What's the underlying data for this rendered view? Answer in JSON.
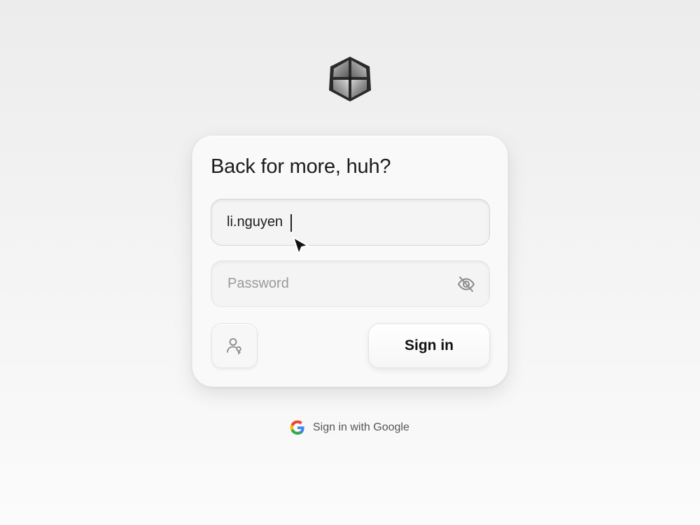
{
  "logo": {
    "icon": "hexagon-logo-icon"
  },
  "form": {
    "title": "Back for more, huh?",
    "username": {
      "value": "li.nguyen",
      "placeholder": ""
    },
    "password": {
      "value": "",
      "placeholder": "Password",
      "toggle_icon": "eye-off-icon"
    },
    "passkey_icon": "user-key-icon",
    "signin_label": "Sign in"
  },
  "google": {
    "label": "Sign in with Google",
    "icon": "google-g-icon"
  },
  "colors": {
    "title": "#1b1b1b",
    "placeholder": "#9a9a9a",
    "link": "#555555"
  }
}
